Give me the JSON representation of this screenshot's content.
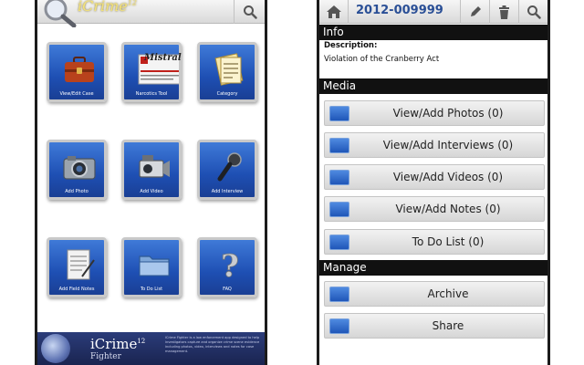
{
  "left_app": {
    "logo_text": "iCrime",
    "logo_superscript": "12",
    "tiles": [
      {
        "label": "View/Edit Case",
        "icon": "briefcase-icon"
      },
      {
        "label": "Narcotics Tool",
        "icon": "mistral-kit-icon",
        "brand": "Mistral"
      },
      {
        "label": "Category",
        "icon": "category-list-icon"
      },
      {
        "label": "Add Photo",
        "icon": "camera-icon"
      },
      {
        "label": "Add Video",
        "icon": "video-camera-icon"
      },
      {
        "label": "Add Interview",
        "icon": "microphone-icon"
      },
      {
        "label": "Add Field Notes",
        "icon": "notepad-icon"
      },
      {
        "label": "To Do List",
        "icon": "folder-icon"
      },
      {
        "label": "FAQ",
        "icon": "question-icon"
      }
    ],
    "banner": {
      "title": "iCrime",
      "title_superscript": "12",
      "subtitle": "Fighter",
      "text": "iCrime Fighter is a law enforcement app designed to help investigators capture and organize crime scene evidence including photos, video, interviews and notes for case management."
    }
  },
  "right_app": {
    "case_number": "2012-009999",
    "sections": {
      "info": "Info",
      "media": "Media",
      "manage": "Manage"
    },
    "description_label": "Description:",
    "description_value": "Violation of the Cranberry Act",
    "media_buttons": [
      {
        "label": "View/Add Photos (0)",
        "icon": "photo-icon"
      },
      {
        "label": "View/Add Interviews (0)",
        "icon": "interview-icon"
      },
      {
        "label": "View/Add Videos (0)",
        "icon": "video-icon"
      },
      {
        "label": "View/Add Notes (0)",
        "icon": "notes-icon"
      },
      {
        "label": "To Do List (0)",
        "icon": "todo-icon"
      }
    ],
    "manage_buttons": [
      {
        "label": "Archive",
        "icon": "archive-icon"
      },
      {
        "label": "Share",
        "icon": "share-icon"
      }
    ]
  }
}
